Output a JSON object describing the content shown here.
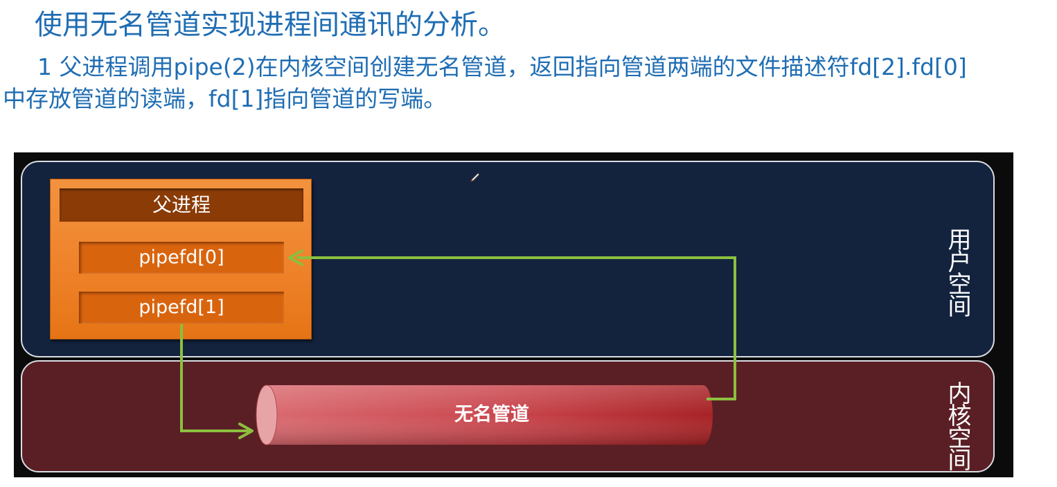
{
  "title": "使用无名管道实现进程间通讯的分析。",
  "description": {
    "line1": "1  父进程调用pipe(2)在内核空间创建无名管道，返回指向管道两端的文件描述符fd[2].fd[0]",
    "line2": "中存放管道的读端，fd[1]指向管道的写端。"
  },
  "diagram": {
    "user_space_label": "用户空间",
    "kernel_space_label": "内核空间",
    "parent_process": {
      "title": "父进程",
      "fd_read": "pipefd[0]",
      "fd_write": "pipefd[1]"
    },
    "pipe_label": "无名管道",
    "colors": {
      "heading_text": "#1f6db3",
      "user_space": "#13233e",
      "kernel_space": "#5a1f25",
      "process_box": "#ee8128",
      "arrow": "#8cbf3f",
      "pipe": "#c9454c"
    }
  }
}
